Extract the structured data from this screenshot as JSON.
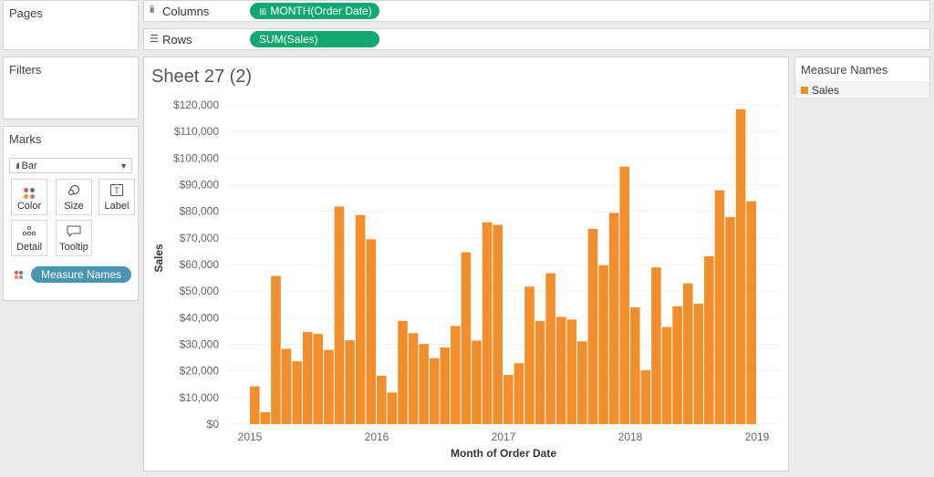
{
  "pages": {
    "title": "Pages"
  },
  "filters": {
    "title": "Filters"
  },
  "marks": {
    "title": "Marks",
    "mark_type": "Bar",
    "buttons": {
      "color": "Color",
      "size": "Size",
      "label": "Label",
      "detail": "Detail",
      "tooltip": "Tooltip"
    },
    "field_pill": "Measure Names"
  },
  "shelves": {
    "columns": {
      "label": "Columns",
      "pill": "MONTH(Order Date)"
    },
    "rows": {
      "label": "Rows",
      "pill": "SUM(Sales)"
    }
  },
  "sheet": {
    "title": "Sheet 27 (2)"
  },
  "legend": {
    "title": "Measure Names",
    "items": [
      {
        "label": "Sales"
      }
    ]
  },
  "colors": {
    "bar": "#f28e2b",
    "columns_pill": "#12a86f",
    "rows_pill": "#12a86f",
    "measure_pill": "#4996b2"
  },
  "chart_data": {
    "type": "bar",
    "title": "Sheet 27 (2)",
    "xlabel": "Month of Order Date",
    "ylabel": "Sales",
    "x_ticks": [
      "2015",
      "2016",
      "2017",
      "2018",
      "2019"
    ],
    "y_ticks": [
      "$0",
      "$10,000",
      "$20,000",
      "$30,000",
      "$40,000",
      "$50,000",
      "$60,000",
      "$70,000",
      "$80,000",
      "$90,000",
      "$100,000",
      "$110,000",
      "$120,000"
    ],
    "ylim": [
      0,
      120000
    ],
    "grid": true,
    "legend": "right",
    "categories": [
      "2015-01",
      "2015-02",
      "2015-03",
      "2015-04",
      "2015-05",
      "2015-06",
      "2015-07",
      "2015-08",
      "2015-09",
      "2015-10",
      "2015-11",
      "2015-12",
      "2016-01",
      "2016-02",
      "2016-03",
      "2016-04",
      "2016-05",
      "2016-06",
      "2016-07",
      "2016-08",
      "2016-09",
      "2016-10",
      "2016-11",
      "2016-12",
      "2017-01",
      "2017-02",
      "2017-03",
      "2017-04",
      "2017-05",
      "2017-06",
      "2017-07",
      "2017-08",
      "2017-09",
      "2017-10",
      "2017-11",
      "2017-12",
      "2018-01",
      "2018-02",
      "2018-03",
      "2018-04",
      "2018-05",
      "2018-06",
      "2018-07",
      "2018-08",
      "2018-09",
      "2018-10",
      "2018-11",
      "2018-12"
    ],
    "series": [
      {
        "name": "Sales",
        "values": [
          14200,
          4500,
          55700,
          28300,
          23600,
          34600,
          33900,
          27900,
          81800,
          31500,
          78600,
          69500,
          18200,
          11900,
          38800,
          34200,
          30100,
          24800,
          28800,
          36900,
          64600,
          31400,
          75900,
          74900,
          18500,
          22900,
          51700,
          38800,
          56700,
          40300,
          39300,
          31100,
          73400,
          59700,
          79400,
          96800,
          43900,
          20300,
          58900,
          36500,
          44300,
          52900,
          45300,
          63100,
          87900,
          77800,
          118400,
          83800
        ]
      }
    ]
  }
}
